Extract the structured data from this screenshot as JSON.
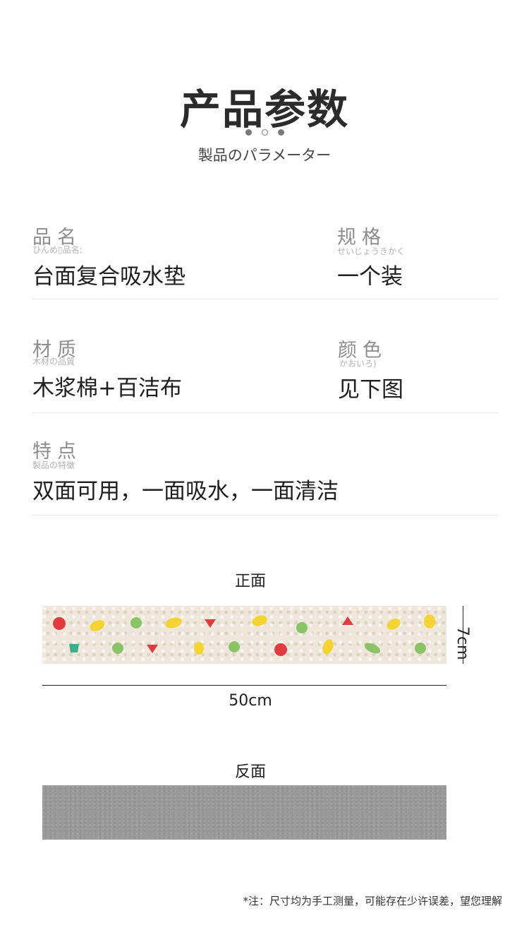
{
  "header": {
    "title": "产品参数",
    "subtitle": "製品のパラメーター"
  },
  "params": {
    "name": {
      "label": "品名",
      "ruby": "ひんめ▯品名:",
      "value": "台面复合吸水垫"
    },
    "spec": {
      "label": "规格",
      "ruby": "せいじょうきかく",
      "value": "一个装"
    },
    "material": {
      "label": "材质",
      "ruby": "木材の品質",
      "value": "木浆棉+百洁布"
    },
    "color": {
      "label": "颜色",
      "ruby": "かおいろ)",
      "value": "见下图"
    },
    "feature": {
      "label": "特点",
      "ruby": "製品の特徴",
      "value": "双面可用，一面吸水，一面清洁"
    }
  },
  "front": {
    "label": "正面",
    "width": "50cm",
    "height": "7cm",
    "pattern_colors": {
      "red": "#e23b3f",
      "yellow": "#f3d431",
      "green": "#8bc466",
      "teal": "#3cae8a"
    }
  },
  "back": {
    "label": "反面",
    "color": "#9a9a9a"
  },
  "footer": {
    "note": "*注：尺寸均为手工测量，可能存在少许误差，望您理解"
  }
}
